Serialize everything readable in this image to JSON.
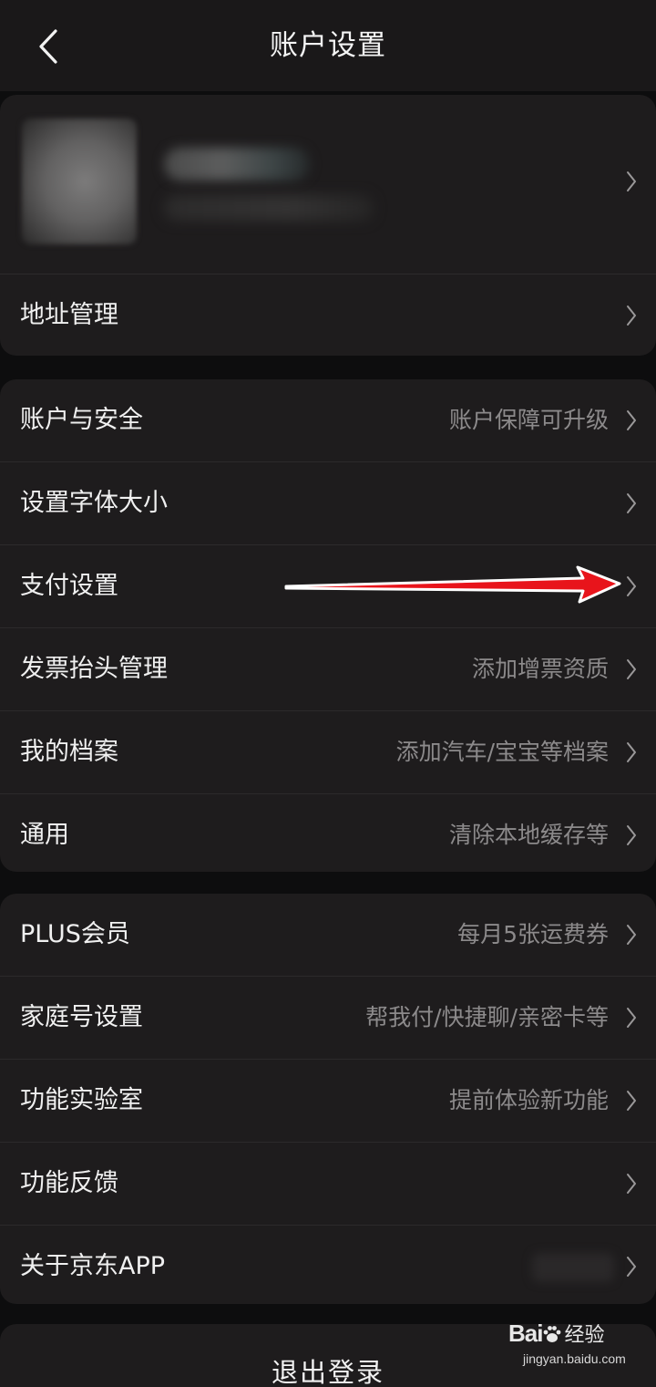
{
  "header": {
    "title": "账户设置"
  },
  "profile": {},
  "section1": {
    "items": [
      {
        "label": "地址管理",
        "value": ""
      }
    ]
  },
  "section2": {
    "items": [
      {
        "label": "账户与安全",
        "value": "账户保障可升级"
      },
      {
        "label": "设置字体大小",
        "value": ""
      },
      {
        "label": "支付设置",
        "value": ""
      },
      {
        "label": "发票抬头管理",
        "value": "添加增票资质"
      },
      {
        "label": "我的档案",
        "value": "添加汽车/宝宝等档案"
      },
      {
        "label": "通用",
        "value": "清除本地缓存等"
      }
    ]
  },
  "section3": {
    "items": [
      {
        "label": "PLUS会员",
        "value": "每月5张运费券"
      },
      {
        "label": "家庭号设置",
        "value": "帮我付/快捷聊/亲密卡等"
      },
      {
        "label": "功能实验室",
        "value": "提前体验新功能"
      },
      {
        "label": "功能反馈",
        "value": ""
      },
      {
        "label": "关于京东APP",
        "value": ""
      }
    ]
  },
  "logout": {
    "label": "退出登录"
  },
  "watermark": {
    "logo_text": "Bai",
    "logo_suffix": "经验",
    "url": "jingyan.baidu.com"
  },
  "icons": {
    "back": "chevron-left-icon",
    "row": "chevron-right-icon",
    "annotation": "red-arrow-icon"
  },
  "colors": {
    "background": "#0d0d0e",
    "header": "#1a1819",
    "card": "#1e1c1d",
    "secondary_text": "#8c8a8b",
    "arrow": "#e8141b"
  }
}
